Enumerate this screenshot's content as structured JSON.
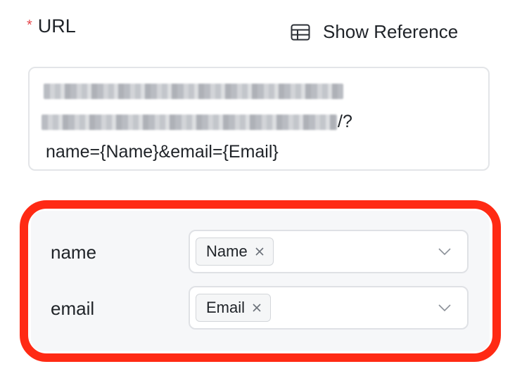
{
  "url_field": {
    "required_mark": "*",
    "label": "URL",
    "show_reference_label": "Show Reference",
    "value_visible_suffix": "/?",
    "value_query": "name={Name}&email={Email}"
  },
  "params": [
    {
      "label": "name",
      "tag": "Name"
    },
    {
      "label": "email",
      "tag": "Email"
    }
  ],
  "colors": {
    "required": "#e5484d",
    "highlight_border": "#ff2a14",
    "params_bg": "#f6f7f9"
  },
  "icons": {
    "show_reference": "table-icon",
    "tag_remove": "close-icon",
    "dropdown": "chevron-down-icon"
  }
}
